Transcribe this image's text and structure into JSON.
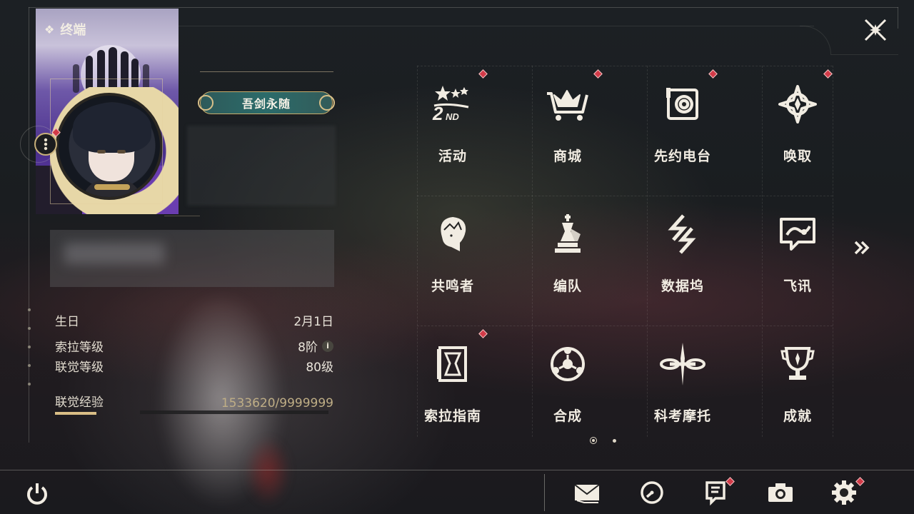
{
  "header": {
    "title": "终端",
    "title_icon": "diamond-grid-icon",
    "close_icon": "close-icon"
  },
  "profile": {
    "title_badge": "吾剑永随",
    "more_icon": "more-vertical-icon",
    "birthday_label": "生日",
    "birthday_value": "2月1日",
    "sola_level_label": "索拉等级",
    "sola_level_value": "8阶",
    "union_level_label": "联觉等级",
    "union_level_value": "80级",
    "union_exp_label": "联觉经验",
    "union_exp_value": "1533620/9999999",
    "union_exp_fraction": 0.153
  },
  "menu": {
    "items": [
      {
        "label": "活动",
        "icon": "events-2nd-icon",
        "badge": true
      },
      {
        "label": "商城",
        "icon": "shop-cart-icon",
        "badge": true
      },
      {
        "label": "先约电台",
        "icon": "radio-icon",
        "badge": true
      },
      {
        "label": "唤取",
        "icon": "convene-compass-icon",
        "badge": true
      },
      {
        "label": "共鸣者",
        "icon": "resonator-portrait-icon",
        "badge": false
      },
      {
        "label": "编队",
        "icon": "team-chess-icon",
        "badge": false
      },
      {
        "label": "数据坞",
        "icon": "data-bank-icon",
        "badge": false
      },
      {
        "label": "飞讯",
        "icon": "message-bubble-icon",
        "badge": false
      },
      {
        "label": "索拉指南",
        "icon": "guidebook-icon",
        "badge": true
      },
      {
        "label": "合成",
        "icon": "synthesis-icon",
        "badge": false
      },
      {
        "label": "科考摩托",
        "icon": "motorbike-icon",
        "badge": false
      },
      {
        "label": "成就",
        "icon": "trophy-icon",
        "badge": false
      }
    ],
    "next_icon": "double-chevron-right-icon",
    "page_count": 2,
    "current_page": 1
  },
  "bottom_bar": {
    "power_icon": "power-icon",
    "mail_icon": "mail-icon",
    "timer_icon": "clock-icon",
    "notice_icon": "notice-icon",
    "camera_icon": "camera-icon",
    "settings_icon": "settings-gear-icon"
  },
  "colors": {
    "accent_gold": "#d9be86",
    "badge_red": "#d23a48",
    "text": "#f1ece2"
  }
}
